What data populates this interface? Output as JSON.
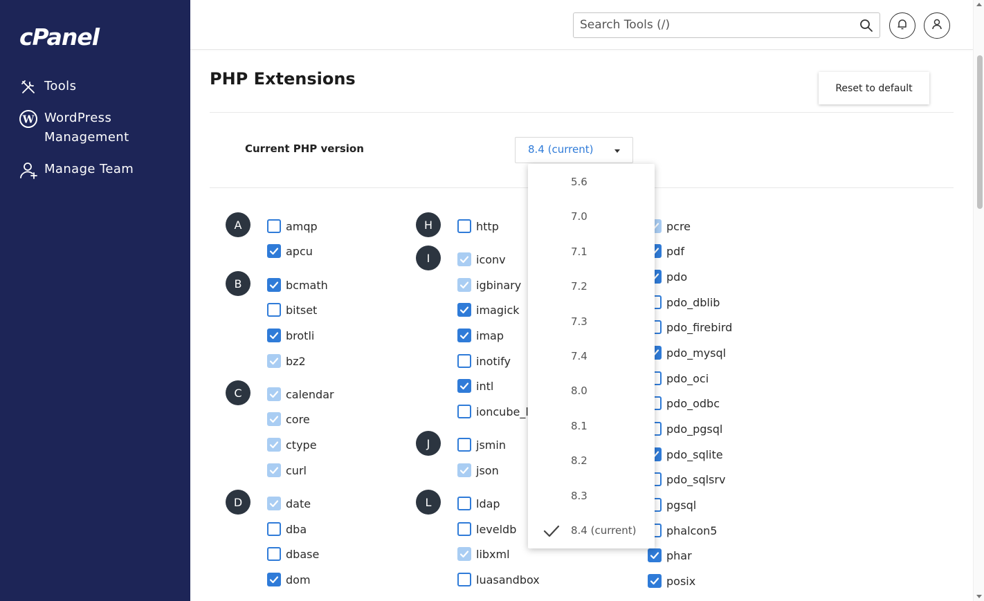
{
  "sidebar": {
    "logo": "cPanel",
    "items": [
      {
        "label": "Tools",
        "icon": "tools-icon"
      },
      {
        "label": "WordPress Management",
        "icon": "wordpress-icon"
      },
      {
        "label": "Manage Team",
        "icon": "user-plus-icon"
      }
    ]
  },
  "header": {
    "search_placeholder": "Search Tools (/)",
    "search_icon": "search-icon",
    "notifications_icon": "bell-icon",
    "account_icon": "user-icon"
  },
  "page": {
    "title": "PHP Extensions",
    "reset_label": "Reset to default",
    "version_label": "Current PHP version",
    "version_value": "8.4 (current)"
  },
  "dropdown": {
    "options": [
      "5.6",
      "7.0",
      "7.1",
      "7.2",
      "7.3",
      "7.4",
      "8.0",
      "8.1",
      "8.2",
      "8.3",
      "8.4 (current)"
    ],
    "selected": "8.4 (current)"
  },
  "columns": {
    "col1": {
      "letters": [
        "A",
        "B",
        "C",
        "D"
      ],
      "items": [
        {
          "name": "amqp",
          "state": "off"
        },
        {
          "name": "apcu",
          "state": "on"
        },
        {
          "name": "bcmath",
          "state": "on"
        },
        {
          "name": "bitset",
          "state": "off"
        },
        {
          "name": "brotli",
          "state": "on"
        },
        {
          "name": "bz2",
          "state": "locked"
        },
        {
          "name": "calendar",
          "state": "locked"
        },
        {
          "name": "core",
          "state": "locked"
        },
        {
          "name": "ctype",
          "state": "locked"
        },
        {
          "name": "curl",
          "state": "locked"
        },
        {
          "name": "date",
          "state": "locked"
        },
        {
          "name": "dba",
          "state": "off"
        },
        {
          "name": "dbase",
          "state": "off"
        },
        {
          "name": "dom",
          "state": "on"
        }
      ]
    },
    "col2": {
      "letters": [
        "H",
        "I",
        "J",
        "L"
      ],
      "items": [
        {
          "name": "http",
          "state": "off"
        },
        {
          "name": "iconv",
          "state": "locked"
        },
        {
          "name": "igbinary",
          "state": "locked"
        },
        {
          "name": "imagick",
          "state": "on"
        },
        {
          "name": "imap",
          "state": "on"
        },
        {
          "name": "inotify",
          "state": "off"
        },
        {
          "name": "intl",
          "state": "on"
        },
        {
          "name": "ioncube_lo",
          "state": "off"
        },
        {
          "name": "jsmin",
          "state": "off"
        },
        {
          "name": "json",
          "state": "locked"
        },
        {
          "name": "ldap",
          "state": "off"
        },
        {
          "name": "leveldb",
          "state": "off"
        },
        {
          "name": "libxml",
          "state": "locked"
        },
        {
          "name": "luasandbox",
          "state": "off"
        }
      ]
    },
    "col3": {
      "items": [
        {
          "name": "pcre",
          "state": "locked"
        },
        {
          "name": "pdf",
          "state": "on"
        },
        {
          "name": "pdo",
          "state": "on"
        },
        {
          "name": "pdo_dblib",
          "state": "off"
        },
        {
          "name": "pdo_firebird",
          "state": "off"
        },
        {
          "name": "pdo_mysql",
          "state": "on"
        },
        {
          "name": "pdo_oci",
          "state": "off"
        },
        {
          "name": "pdo_odbc",
          "state": "off"
        },
        {
          "name": "pdo_pgsql",
          "state": "off"
        },
        {
          "name": "pdo_sqlite",
          "state": "on"
        },
        {
          "name": "pdo_sqlsrv",
          "state": "off"
        },
        {
          "name": "pgsql",
          "state": "off"
        },
        {
          "name": "phalcon5",
          "state": "off"
        },
        {
          "name": "phar",
          "state": "on"
        },
        {
          "name": "posix",
          "state": "on"
        }
      ]
    }
  },
  "colors": {
    "sidebar_bg": "#1d2557",
    "accent": "#2f7bd8",
    "locked_checkbox": "#a9cdf3",
    "letter_badge": "#2c3540"
  }
}
